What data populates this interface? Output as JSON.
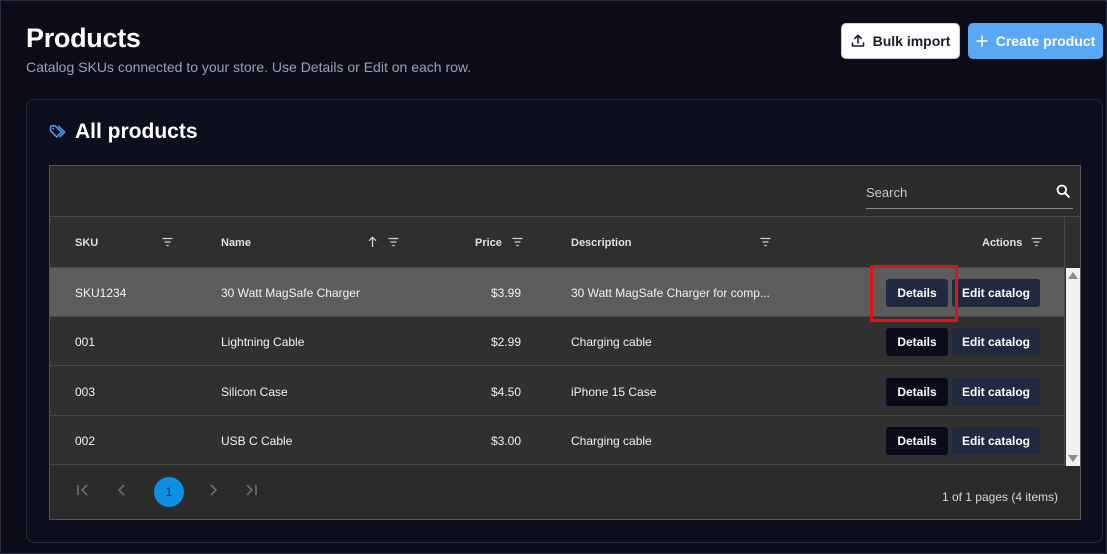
{
  "header": {
    "title": "Products",
    "subtitle": "Catalog SKUs connected to your store. Use Details or Edit on each row.",
    "bulk_import_label": "Bulk import",
    "create_product_label": "Create product"
  },
  "card": {
    "title": "All products",
    "icon": "tag-icon"
  },
  "search": {
    "placeholder": "Search",
    "value": ""
  },
  "columns": {
    "sku": "SKU",
    "name": "Name",
    "price": "Price",
    "description": "Description",
    "actions": "Actions"
  },
  "rows": [
    {
      "sku": "SKU1234",
      "name": "30 Watt MagSafe Charger",
      "price": "$3.99",
      "description": "30 Watt MagSafe Charger for comp...",
      "details_label": "Details",
      "edit_label": "Edit catalog"
    },
    {
      "sku": "001",
      "name": "Lightning Cable",
      "price": "$2.99",
      "description": "Charging cable",
      "details_label": "Details",
      "edit_label": "Edit catalog"
    },
    {
      "sku": "003",
      "name": "Silicon Case",
      "price": "$4.50",
      "description": "iPhone 15 Case",
      "details_label": "Details",
      "edit_label": "Edit catalog"
    },
    {
      "sku": "002",
      "name": "USB C Cable",
      "price": "$3.00",
      "description": "Charging cable",
      "details_label": "Details",
      "edit_label": "Edit catalog"
    }
  ],
  "pager": {
    "current_page": "1",
    "info": "1 of 1 pages (4 items)"
  },
  "colors": {
    "background": "#0b0c18",
    "accent": "#59a8f5",
    "pager_active": "#0c8fe0",
    "highlight": "#e0121e"
  }
}
